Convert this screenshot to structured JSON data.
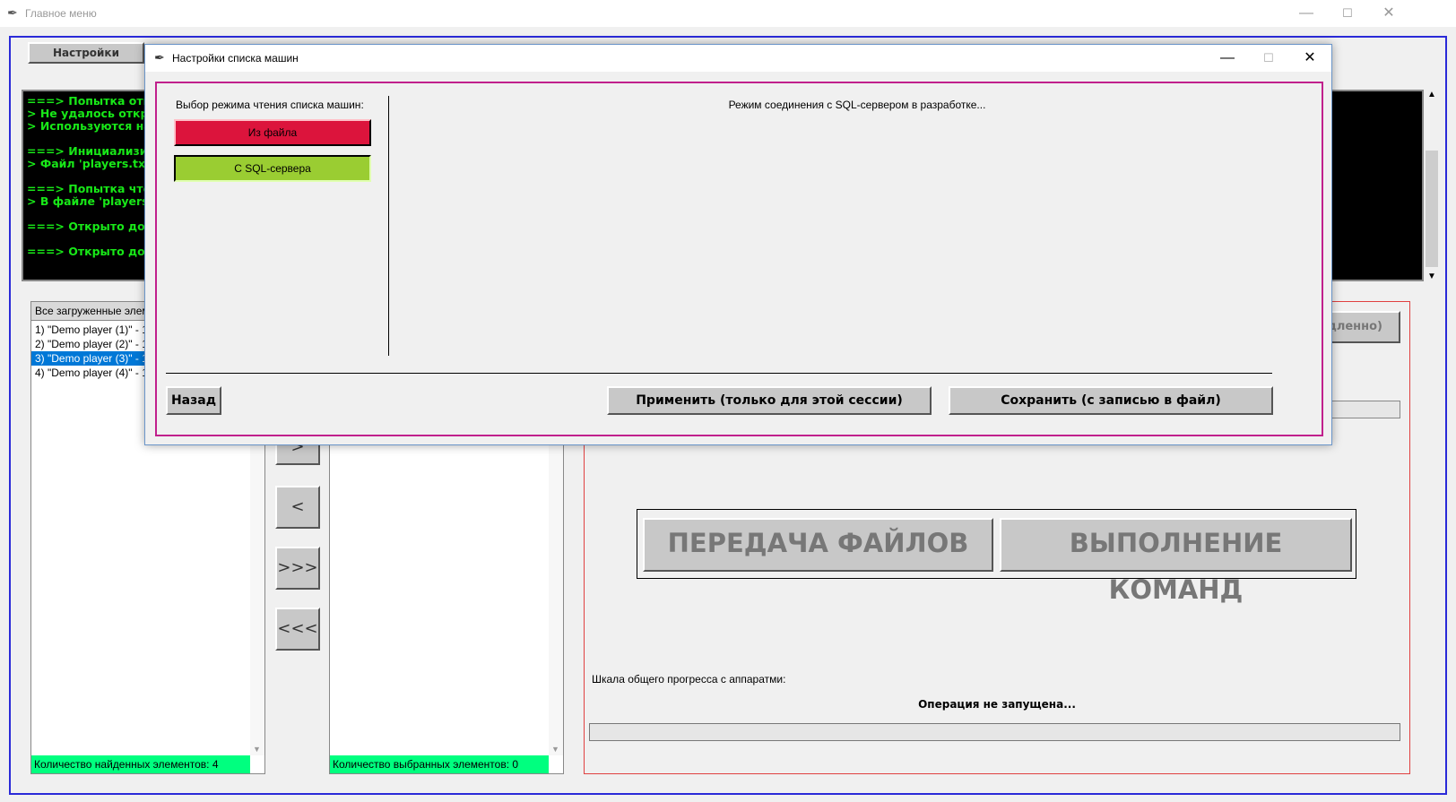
{
  "main_window": {
    "title": "Главное меню",
    "settings_button": "Настройки"
  },
  "console": {
    "lines": [
      "===> Попытка откр",
      "> Не удалось откры",
      "> Используются на",
      "",
      "===> Инициализир",
      "> Файл 'players.txt'",
      "",
      "===> Попытка чтен",
      "> В файле 'players.",
      "",
      "===> Открыто доч",
      "",
      "===> Открыто доч"
    ]
  },
  "left_list": {
    "header": "Все загруженные элем",
    "items": [
      "1) \"Demo player (1)\" - 1",
      "2) \"Demo player (2)\" - 1",
      "3) \"Demo player (3)\" - 1",
      "4) \"Demo player (4)\" - 1"
    ],
    "selected_index": 2,
    "footer": "Количество найденных элементов: 4"
  },
  "right_list": {
    "footer": "Количество выбранных элементов: 0"
  },
  "transfer_buttons": {
    "move_right": ">",
    "move_left": "<",
    "move_all_right": ">>>",
    "move_all_left": "<<<"
  },
  "right_panel": {
    "partial_button": "едленно)",
    "file_transfer_button": "ПЕРЕДАЧА ФАЙЛОВ",
    "command_exec_button": "ВЫПОЛНЕНИЕ КОМАНД",
    "progress_label": "Шкала общего прогресса с аппаратми:",
    "status": "Операция не запущена...",
    "progress": 0
  },
  "dialog": {
    "title": "Настройки списка машин",
    "mode_label": "Выбор режима чтения списка машин:",
    "from_file_button": "Из файла",
    "from_sql_button": "С SQL-сервера",
    "info_text": "Режим соединения с SQL-сервером в разработке...",
    "back_button": "Назад",
    "apply_button": "Применить (только для этой сессии)",
    "save_button": "Сохранить (с записью в файл)"
  },
  "colors": {
    "from_file": "#dc143c",
    "from_sql": "#9acd32",
    "console_text": "#18e818",
    "status_green": "#00ff7f"
  }
}
